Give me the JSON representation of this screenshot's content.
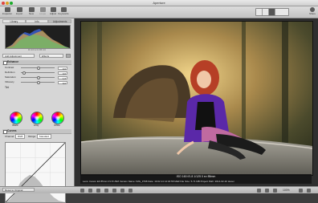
{
  "window": {
    "title": "Aperture"
  },
  "toolbar": {
    "buttons": [
      {
        "label": "Inspector",
        "icon": "inspector-icon"
      },
      {
        "label": "Import",
        "icon": "import-icon"
      },
      {
        "label": "New",
        "icon": "new-icon"
      },
      {
        "label": "Loupe",
        "icon": "loupe-icon"
      },
      {
        "label": "Adjust",
        "icon": "adjust-icon"
      },
      {
        "label": "Keywords",
        "icon": "keywords-icon"
      },
      {
        "label": "Share",
        "icon": "share-icon"
      }
    ],
    "right_label": "Viewer"
  },
  "inspector": {
    "tabs": [
      "Library",
      "Info",
      "Adjustments"
    ],
    "histogram_info": "R 0.0 G 0.0 B 0.0",
    "presets": {
      "left": "Add Adjustment",
      "right": "Effects"
    },
    "enhance": {
      "title": "Enhance",
      "rows": [
        {
          "label": "Contrast",
          "value": "0,0",
          "pos": 0.5
        },
        {
          "label": "Definition",
          "value": "0,0",
          "pos": 0.1
        },
        {
          "label": "Saturation",
          "value": "1,0",
          "pos": 0.5
        },
        {
          "label": "Vibrancy",
          "value": "0,0",
          "pos": 0.5
        }
      ],
      "tint_label": "Tint",
      "wheels": [
        "Black",
        "Gray",
        "White"
      ]
    },
    "curves": {
      "title": "Curves",
      "channel_label": "Channel:",
      "channel_value": "RGB",
      "range_label": "Range:",
      "range_value": "Standard"
    },
    "bottom_button": "Reset to Original"
  },
  "viewer": {
    "meta_top": "ISO 160   f/1.8   1/125   0 ev   85mm",
    "meta_bottom": "Lens: Canon EF 85mm f/1.8 USM   Version Name: IMG_3798   Date: 10.02.14 14:34:58 MEZ   File Size: 5.71 MB   Project Path: 2014-02-10 Hexer"
  },
  "status": {
    "zoom": "100%"
  }
}
